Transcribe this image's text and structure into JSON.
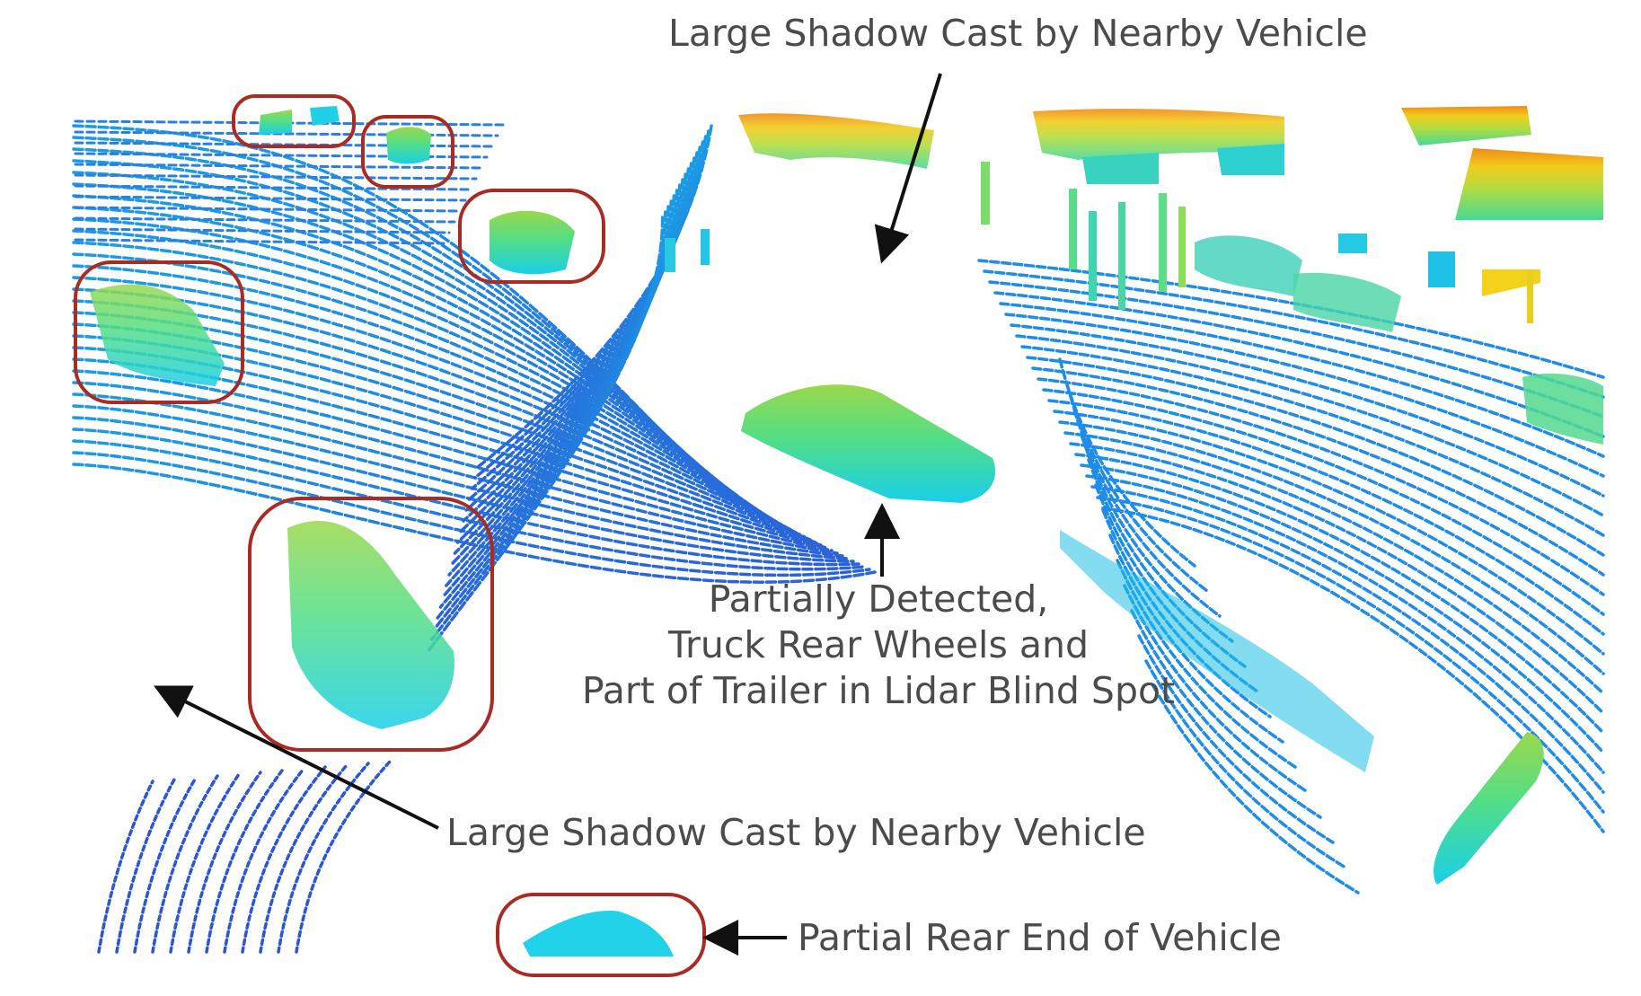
{
  "annotations": {
    "shadow_top": "Large Shadow Cast by Nearby Vehicle",
    "truck_line_1": "Partially Detected,",
    "truck_line_2": "Truck Rear Wheels and",
    "truck_line_3": "Part of Trailer in Lidar Blind Spot",
    "shadow_bottom": "Large Shadow Cast by Nearby Vehicle",
    "rear_end": "Partial Rear End of Vehicle"
  },
  "colors": {
    "near_ground": "#2b63d8",
    "far_ground": "#1f8de8",
    "cyan_object": "#16d4e8",
    "green_object": "#55e08c",
    "yellow_object": "#f2d21b",
    "orange_object": "#f28a16",
    "highlight_box": "#a82b24",
    "arrow": "#111111",
    "caption_text": "#4b4b4b"
  }
}
